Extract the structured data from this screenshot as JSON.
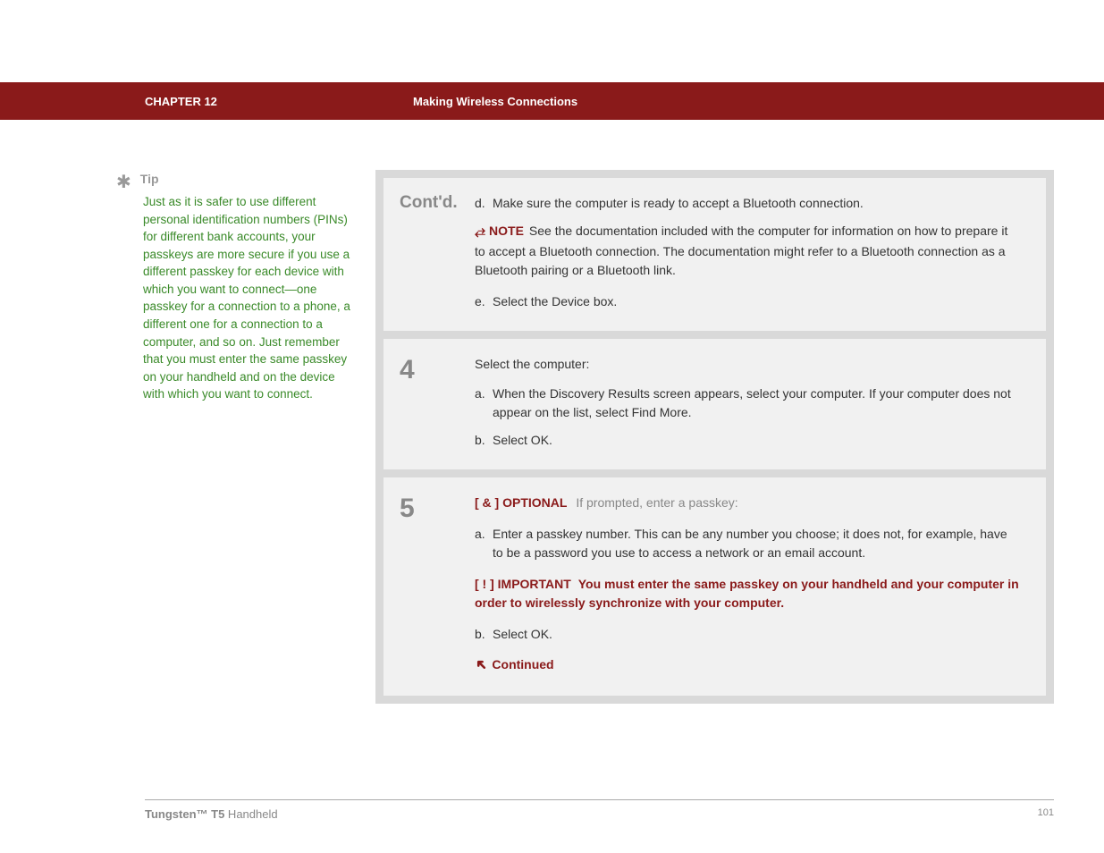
{
  "header": {
    "chapter": "CHAPTER 12",
    "title": "Making Wireless Connections"
  },
  "sidebar": {
    "tip_label": "Tip",
    "tip_body": "Just as it is safer to use different personal identification numbers (PINs) for different bank accounts, your passkeys are more secure if you use a different passkey for each device with which you want to connect—one passkey for a connection to a phone, a different one for a connection to a computer, and so on. Just remember that you must enter the same passkey on your handheld and on the device with which you want to connect."
  },
  "steps": {
    "contd": {
      "label": "Cont'd.",
      "d": "Make sure the computer is ready to accept a Bluetooth connection.",
      "note_label": "NOTE",
      "note_text": "See the documentation included with the computer for information on how to prepare it to accept a Bluetooth connection. The documentation might refer to a Bluetooth connection as a Bluetooth pairing or a Bluetooth link.",
      "e": "Select the Device box."
    },
    "s4": {
      "num": "4",
      "intro": "Select the computer:",
      "a": "When the Discovery Results screen appears, select your computer. If your computer does not appear on the list, select Find More.",
      "b": "Select OK."
    },
    "s5": {
      "num": "5",
      "optional_bracket": "[ & ]",
      "optional_label": "OPTIONAL",
      "optional_text": "If prompted, enter a passkey:",
      "a": "Enter a passkey number. This can be any number you choose; it does not, for example, have to be a password you use to access a network or an email account.",
      "important_bracket": "[ ! ]",
      "important_label": "IMPORTANT",
      "important_text": "You must enter the same passkey on your handheld and your computer in order to wirelessly synchronize with your computer.",
      "b": "Select OK.",
      "continued": "Continued"
    }
  },
  "footer": {
    "product_bold": "Tungsten™ T5",
    "product_rest": " Handheld",
    "page": "101"
  }
}
